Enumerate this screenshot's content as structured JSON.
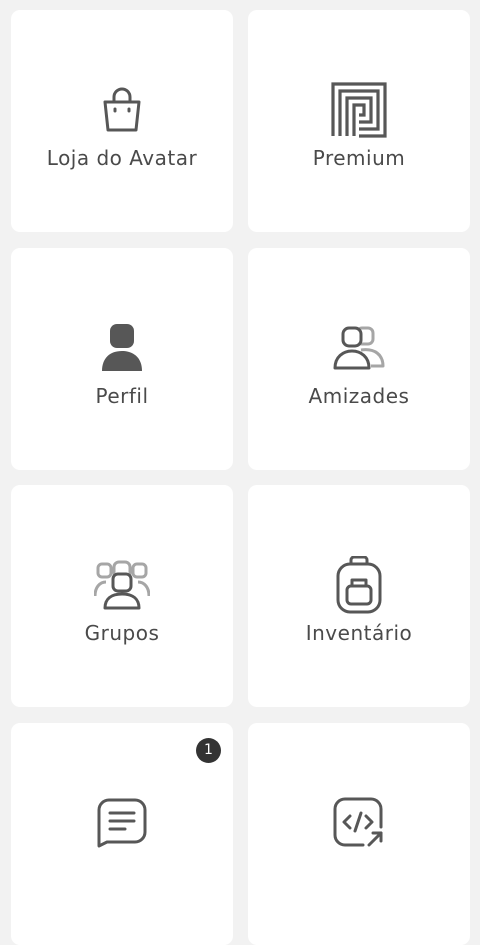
{
  "menu": {
    "tiles": [
      {
        "label": "Loja do Avatar",
        "icon": "shopping-bag-icon"
      },
      {
        "label": "Premium",
        "icon": "premium-icon"
      },
      {
        "label": "Perfil",
        "icon": "profile-icon"
      },
      {
        "label": "Amizades",
        "icon": "friends-icon"
      },
      {
        "label": "Grupos",
        "icon": "groups-icon"
      },
      {
        "label": "Inventário",
        "icon": "backpack-icon"
      },
      {
        "label": "",
        "icon": "message-icon",
        "badge": "1"
      },
      {
        "label": "",
        "icon": "code-share-icon"
      }
    ]
  },
  "colors": {
    "background": "#f2f2f2",
    "tile": "#ffffff",
    "icon": "#575757",
    "text": "#4a4a4a",
    "badge": "#333333"
  }
}
